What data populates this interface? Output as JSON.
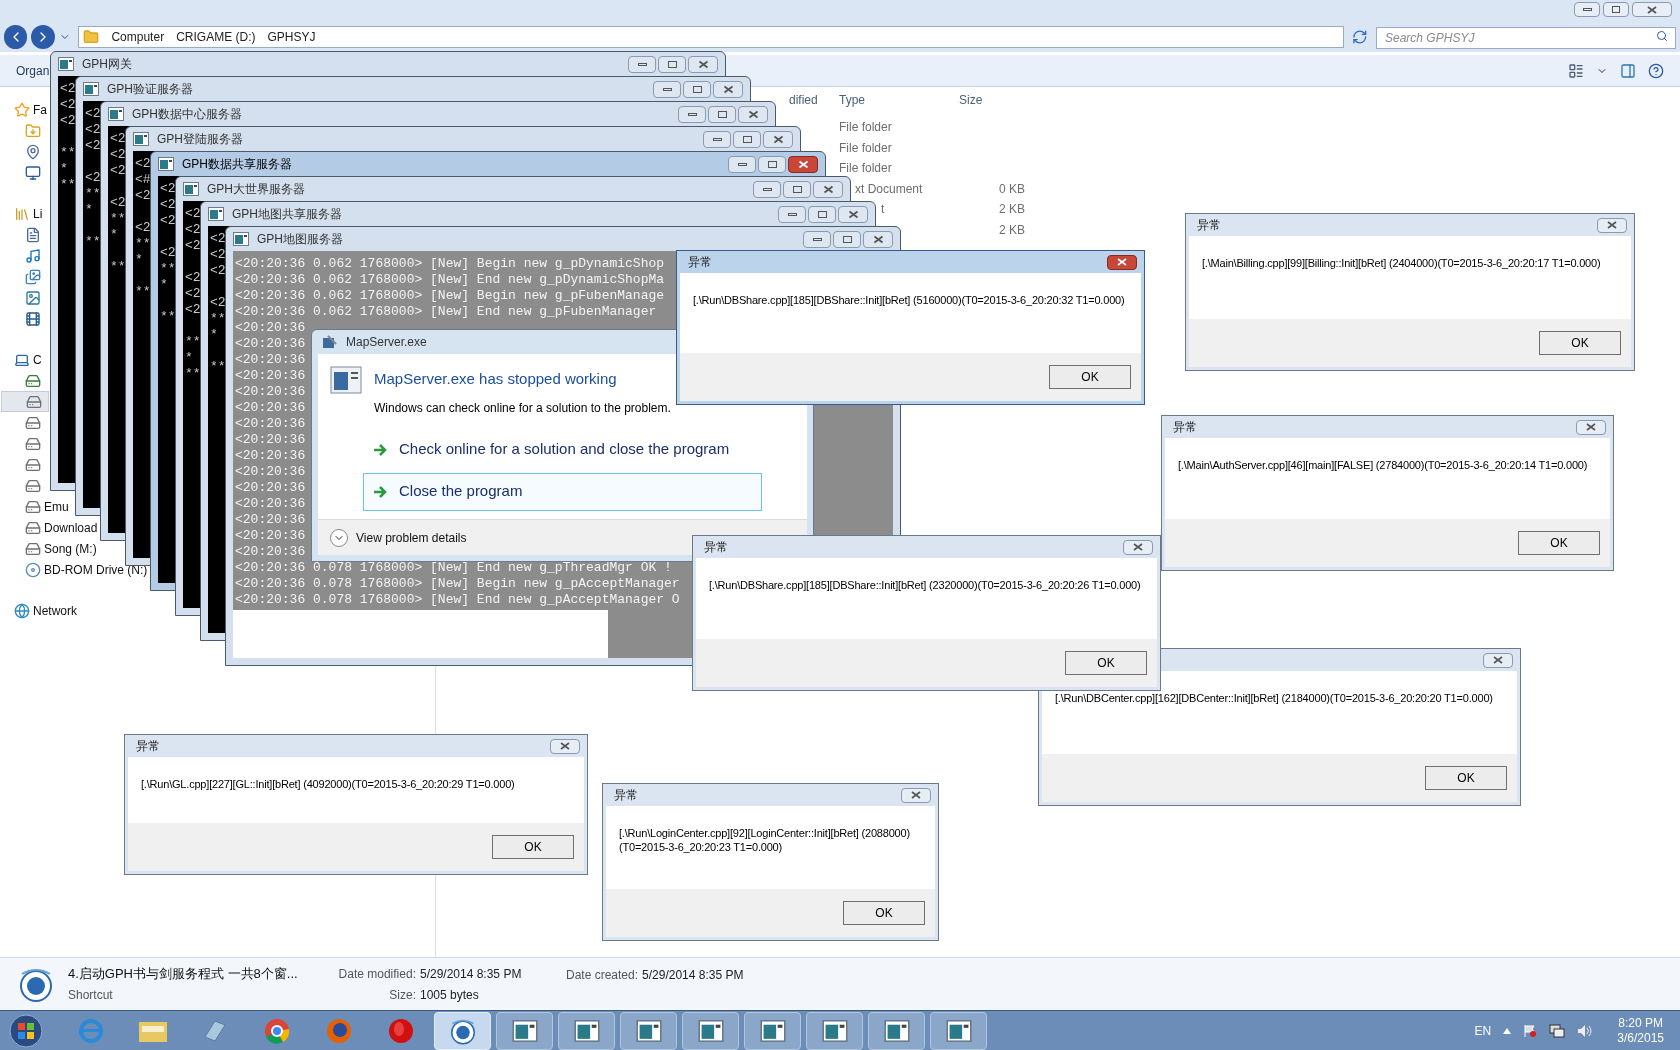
{
  "explorer": {
    "breadcrumb": [
      "Computer",
      "CRIGAME (D:)",
      "GPHSYJ"
    ],
    "search": {
      "placeholder": "Search GPHSYJ"
    },
    "toolbar_label": "Organ",
    "nav_groups": [
      {
        "items": [
          {
            "kind": "star",
            "label": "Fa",
            "selected": false
          },
          {
            "kind": "download",
            "selected": false
          },
          {
            "kind": "places",
            "selected": false
          },
          {
            "kind": "desktop",
            "selected": false
          }
        ]
      },
      {
        "items": [
          {
            "kind": "library",
            "label": "Li",
            "selected": false
          },
          {
            "kind": "document",
            "selected": false
          },
          {
            "kind": "music",
            "selected": false
          },
          {
            "kind": "pictures",
            "selected": false
          },
          {
            "kind": "image",
            "selected": false
          },
          {
            "kind": "video",
            "selected": false
          }
        ]
      },
      {
        "items": [
          {
            "kind": "computer",
            "label": "C",
            "selected": false
          },
          {
            "kind": "system-drive",
            "selected": false
          },
          {
            "kind": "drive",
            "selected": true
          },
          {
            "kind": "drive",
            "selected": false
          },
          {
            "kind": "drive",
            "selected": false
          },
          {
            "kind": "drive",
            "selected": false
          },
          {
            "kind": "drive",
            "selected": false
          },
          {
            "kind": "drive",
            "label": "Emu",
            "selected": false
          },
          {
            "kind": "drive",
            "label": "Download",
            "selected": false
          },
          {
            "kind": "drive",
            "label": "Song (M:)",
            "selected": false
          },
          {
            "kind": "disc",
            "label": "BD-ROM Drive (N:)",
            "selected": false
          }
        ]
      },
      {
        "items": [
          {
            "kind": "network",
            "label": "Network",
            "selected": false
          }
        ]
      }
    ],
    "columns": [
      "dified",
      "Type",
      "Size"
    ],
    "rows": [
      {
        "type": "File folder"
      },
      {
        "type": "File folder"
      },
      {
        "type": "File folder"
      },
      {
        "type": "xt Document",
        "size": "0 KB"
      },
      {
        "type": "t",
        "size": "2 KB"
      },
      {
        "size": "2 KB"
      }
    ],
    "details": {
      "name": "4.启动GPH书与剑服务程式 一共8个窗...",
      "kind_label": "Shortcut",
      "fields": [
        {
          "label": "Date modified:",
          "value": "5/29/2014 8:35 PM"
        },
        {
          "label": "Size:",
          "value": "1005 bytes"
        },
        {
          "label": "Date created:",
          "value": "5/29/2014 8:35 PM"
        }
      ]
    }
  },
  "consoles": [
    {
      "title": "GPH网关",
      "active": false,
      "kind": "plain",
      "lines": [
        "<2",
        "<2",
        "<2",
        "**",
        "*",
        "**"
      ]
    },
    {
      "title": "GPH验证服务器",
      "active": false,
      "kind": "plain",
      "lines": [
        "<2",
        "<2",
        "<2",
        "<2",
        "**",
        "*",
        "**"
      ]
    },
    {
      "title": "GPH数据中心服务器",
      "active": false,
      "kind": "plain",
      "lines": [
        "<2",
        "<2",
        "<2",
        "<2",
        "**",
        "*",
        "**"
      ]
    },
    {
      "title": "GPH登陆服务器",
      "active": false,
      "kind": "plain",
      "lines": [
        "<2",
        "<#",
        "<2",
        "<2",
        "**",
        "*",
        "**"
      ]
    },
    {
      "title": "GPH数据共享服务器",
      "active": true,
      "kind": "plain",
      "lines": [
        "<2",
        "<2",
        "<2",
        "<2",
        "**",
        "*",
        "**"
      ]
    },
    {
      "title": "GPH大世界服务器",
      "active": false,
      "kind": "plain",
      "lines": [
        "<2",
        "<2",
        "<2",
        "<2",
        "<2",
        "<2",
        "**",
        "*",
        "**"
      ]
    },
    {
      "title": "GPH地图共享服务器",
      "active": false,
      "kind": "plain",
      "lines": [
        "<2",
        "<2",
        "<2",
        "<2",
        "**",
        "*",
        "**"
      ]
    },
    {
      "title": "GPH地图服务器",
      "active": false,
      "kind": "selection",
      "lines": [
        "<20:20:36 0.062 1768000> [New] Begin new g_pDynamicShop",
        "<20:20:36 0.062 1768000> [New] End new g_pDynamicShopMa",
        "<20:20:36 0.062 1768000> [New] Begin new g_pFubenManage",
        "<20:20:36 0.062 1768000> [New] End new g_pFubenManager",
        "<20:20:36",
        "<20:20:36",
        "<20:20:36",
        "<20:20:36",
        "<20:20:36",
        "<20:20:36",
        "<20:20:36",
        "<20:20:36",
        "<20:20:36",
        "<20:20:36",
        "<20:20:36",
        "<20:20:36",
        "<20:20:36",
        "<20:20:36",
        "<20:20:36",
        "<20:20:36 0.078 1768000> [New] End new g_pThreadMgr OK !",
        "<20:20:36 0.078 1768000> [New] Begin new g_pAcceptManager",
        "<20:20:36 0.078 1768000> [New] End new g_pAcceptManager O"
      ]
    }
  ],
  "crash_dialog": {
    "title": "MapServer.exe",
    "heading": "MapServer.exe has stopped working",
    "text": "Windows can check online for a solution to the problem.",
    "options": [
      {
        "label": "Check online for a solution and close the program",
        "selected": false
      },
      {
        "label": "Close the program",
        "selected": true
      }
    ],
    "details_label": "View problem details"
  },
  "error_dialogs": [
    {
      "active": false,
      "message": "[.\\Run\\DBCenter.cpp][162][DBCenter::Init][bRet] (2184000)(T0=2015-3-6_20:20:20 T1=0.000)",
      "button": "OK"
    },
    {
      "title": "异常",
      "active": true,
      "message": "[.\\Run\\DBShare.cpp][185][DBShare::Init][bRet] (5160000)(T0=2015-3-6_20:20:32 T1=0.000)",
      "button": "OK"
    },
    {
      "title": "异常",
      "active": false,
      "message": "[.\\Main\\Billing.cpp][99][Billing::Init][bRet] (2404000)(T0=2015-3-6_20:20:17 T1=0.000)",
      "button": "OK"
    },
    {
      "title": "异常",
      "active": false,
      "message": "[.\\Main\\AuthServer.cpp][46][main][FALSE] (2784000)(T0=2015-3-6_20:20:14 T1=0.000)",
      "button": "OK"
    },
    {
      "title": "异常",
      "active": false,
      "message": "[.\\Run\\DBShare.cpp][185][DBShare::Init][bRet] (2320000)(T0=2015-3-6_20:20:26 T1=0.000)",
      "button": "OK"
    },
    {
      "title": "异常",
      "active": false,
      "message": "[.\\Run\\GL.cpp][227][GL::Init][bRet] (4092000)(T0=2015-3-6_20:20:29 T1=0.000)",
      "button": "OK"
    },
    {
      "title": "异常",
      "active": false,
      "message": "[.\\Run\\LoginCenter.cpp][92][LoginCenter::Init][bRet] (2088000)(T0=2015-3-6_20:20:23 T1=0.000)",
      "button": "OK"
    }
  ],
  "taskbar": {
    "items": [
      {
        "kind": "browser-e",
        "selected": false
      },
      {
        "kind": "folder",
        "selected": false
      },
      {
        "kind": "notepad",
        "selected": false
      },
      {
        "kind": "chrome",
        "selected": false
      },
      {
        "kind": "firefox",
        "selected": false
      },
      {
        "kind": "red-ball",
        "selected": false
      },
      {
        "kind": "gph",
        "selected": true
      },
      {
        "kind": "console",
        "selected": false
      },
      {
        "kind": "console",
        "selected": false
      },
      {
        "kind": "console",
        "selected": false
      },
      {
        "kind": "console",
        "selected": false
      },
      {
        "kind": "console",
        "selected": false
      },
      {
        "kind": "console",
        "selected": false
      },
      {
        "kind": "console",
        "selected": false
      },
      {
        "kind": "console",
        "selected": false
      }
    ],
    "language": "EN",
    "time": "8:20 PM",
    "date": "3/6/2015"
  }
}
